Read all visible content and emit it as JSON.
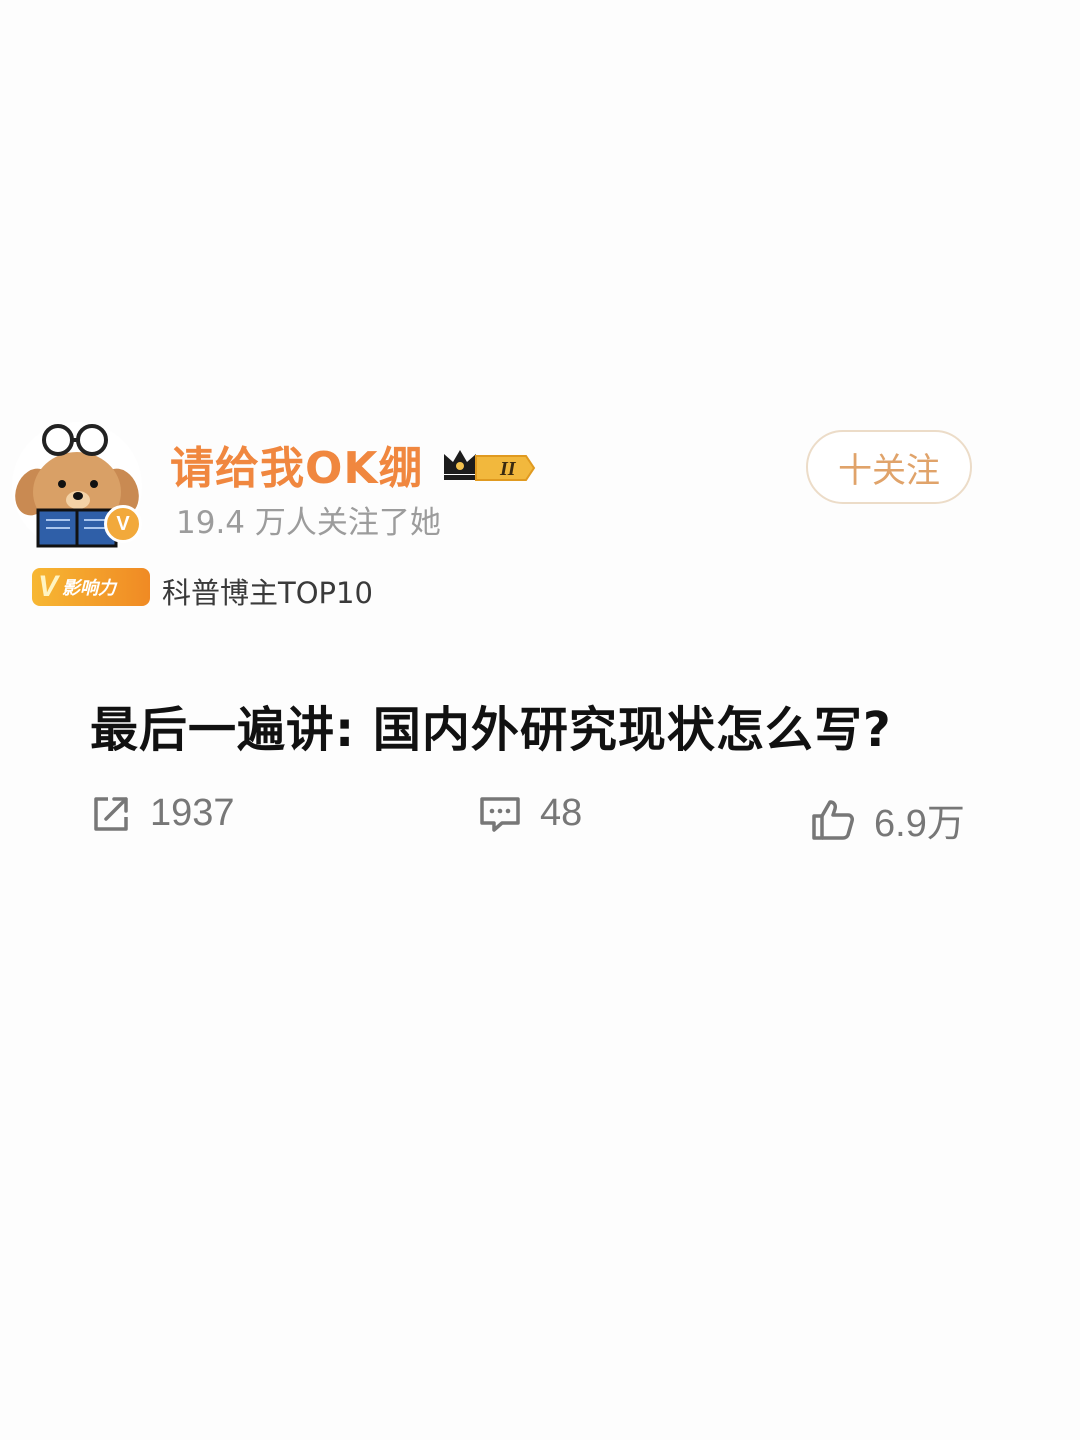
{
  "user": {
    "name": "请给我OK绷",
    "level_badge": "II",
    "followers": "19.4 万人关注了她",
    "verified_badge": "V",
    "follow_button": "十关注",
    "influence_badge_v": "V",
    "influence_badge_text": "影响力",
    "rank": "科普博主TOP10"
  },
  "post": {
    "title": "最后一遍讲: 国内外研究现状怎么写?"
  },
  "stats": {
    "shares": "1937",
    "comments": "48",
    "likes": "6.9万"
  },
  "colors": {
    "username": "#f0873f",
    "follow_button": "#e0a36a",
    "verified": "#f2a93b"
  },
  "icons": [
    "share-icon",
    "comment-icon",
    "like-icon",
    "crown-icon"
  ]
}
